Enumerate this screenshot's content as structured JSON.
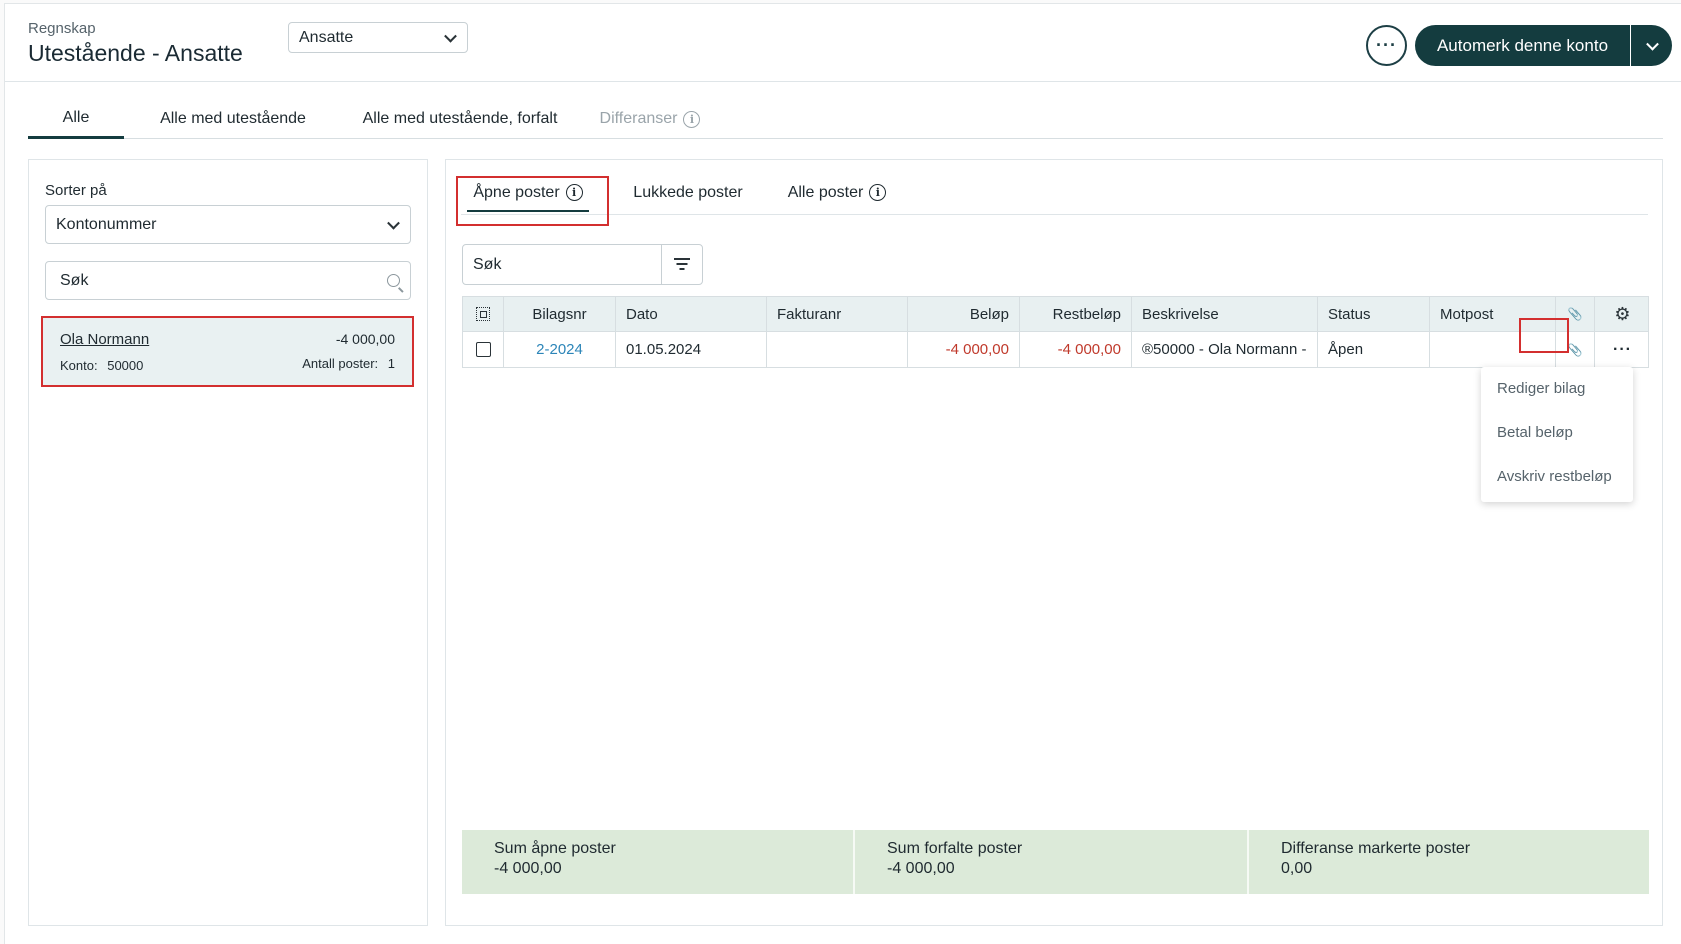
{
  "header": {
    "breadcrumb": "Regnskap",
    "title": "Utestående - Ansatte",
    "group_select": "Ansatte",
    "more_label": "···",
    "primary_action": "Automerk denne konto"
  },
  "main_tabs": [
    {
      "label": "Alle"
    },
    {
      "label": "Alle med utestående"
    },
    {
      "label": "Alle med utestående, forfalt"
    },
    {
      "label": "Differanser"
    }
  ],
  "left": {
    "sort_label": "Sorter på",
    "sort_value": "Kontonummer",
    "search_placeholder": "Søk",
    "account": {
      "name": "Ola Normann",
      "amount": "-4 000,00",
      "konto_label": "Konto:",
      "konto_value": "50000",
      "count_label": "Antall poster:",
      "count_value": "1"
    }
  },
  "sub_tabs": [
    {
      "label": "Åpne poster"
    },
    {
      "label": "Lukkede poster"
    },
    {
      "label": "Alle poster"
    }
  ],
  "table": {
    "search_placeholder": "Søk",
    "columns": [
      "Bilagsnr",
      "Dato",
      "Fakturanr",
      "Beløp",
      "Restbeløp",
      "Beskrivelse",
      "Status",
      "Motpost"
    ],
    "rows": [
      {
        "bilagsnr": "2-2024",
        "dato": "01.05.2024",
        "fakturanr": "",
        "belop": "-4 000,00",
        "restbelop": "-4 000,00",
        "beskrivelse": "®50000 - Ola Normann -",
        "status": "Åpen",
        "motpost": "",
        "menu": "···"
      }
    ]
  },
  "row_menu": [
    "Rediger bilag",
    "Betal beløp",
    "Avskriv restbeløp"
  ],
  "summary": [
    {
      "label": "Sum åpne poster",
      "value": "-4 000,00"
    },
    {
      "label": "Sum forfalte poster",
      "value": "-4 000,00"
    },
    {
      "label": "Differanse markerte poster",
      "value": "0,00"
    }
  ],
  "colors": {
    "primary": "#143c3f",
    "negative": "#c0392b",
    "link": "#2c85b8",
    "highlight": "#d32f2f",
    "summary_bg": "#dcead9",
    "table_header_bg": "#e8f0f1"
  },
  "icons": [
    "chevron-down-icon",
    "info-icon",
    "search-icon",
    "filter-icon",
    "select-all-icon",
    "paperclip-icon",
    "gear-icon",
    "more-icon"
  ]
}
